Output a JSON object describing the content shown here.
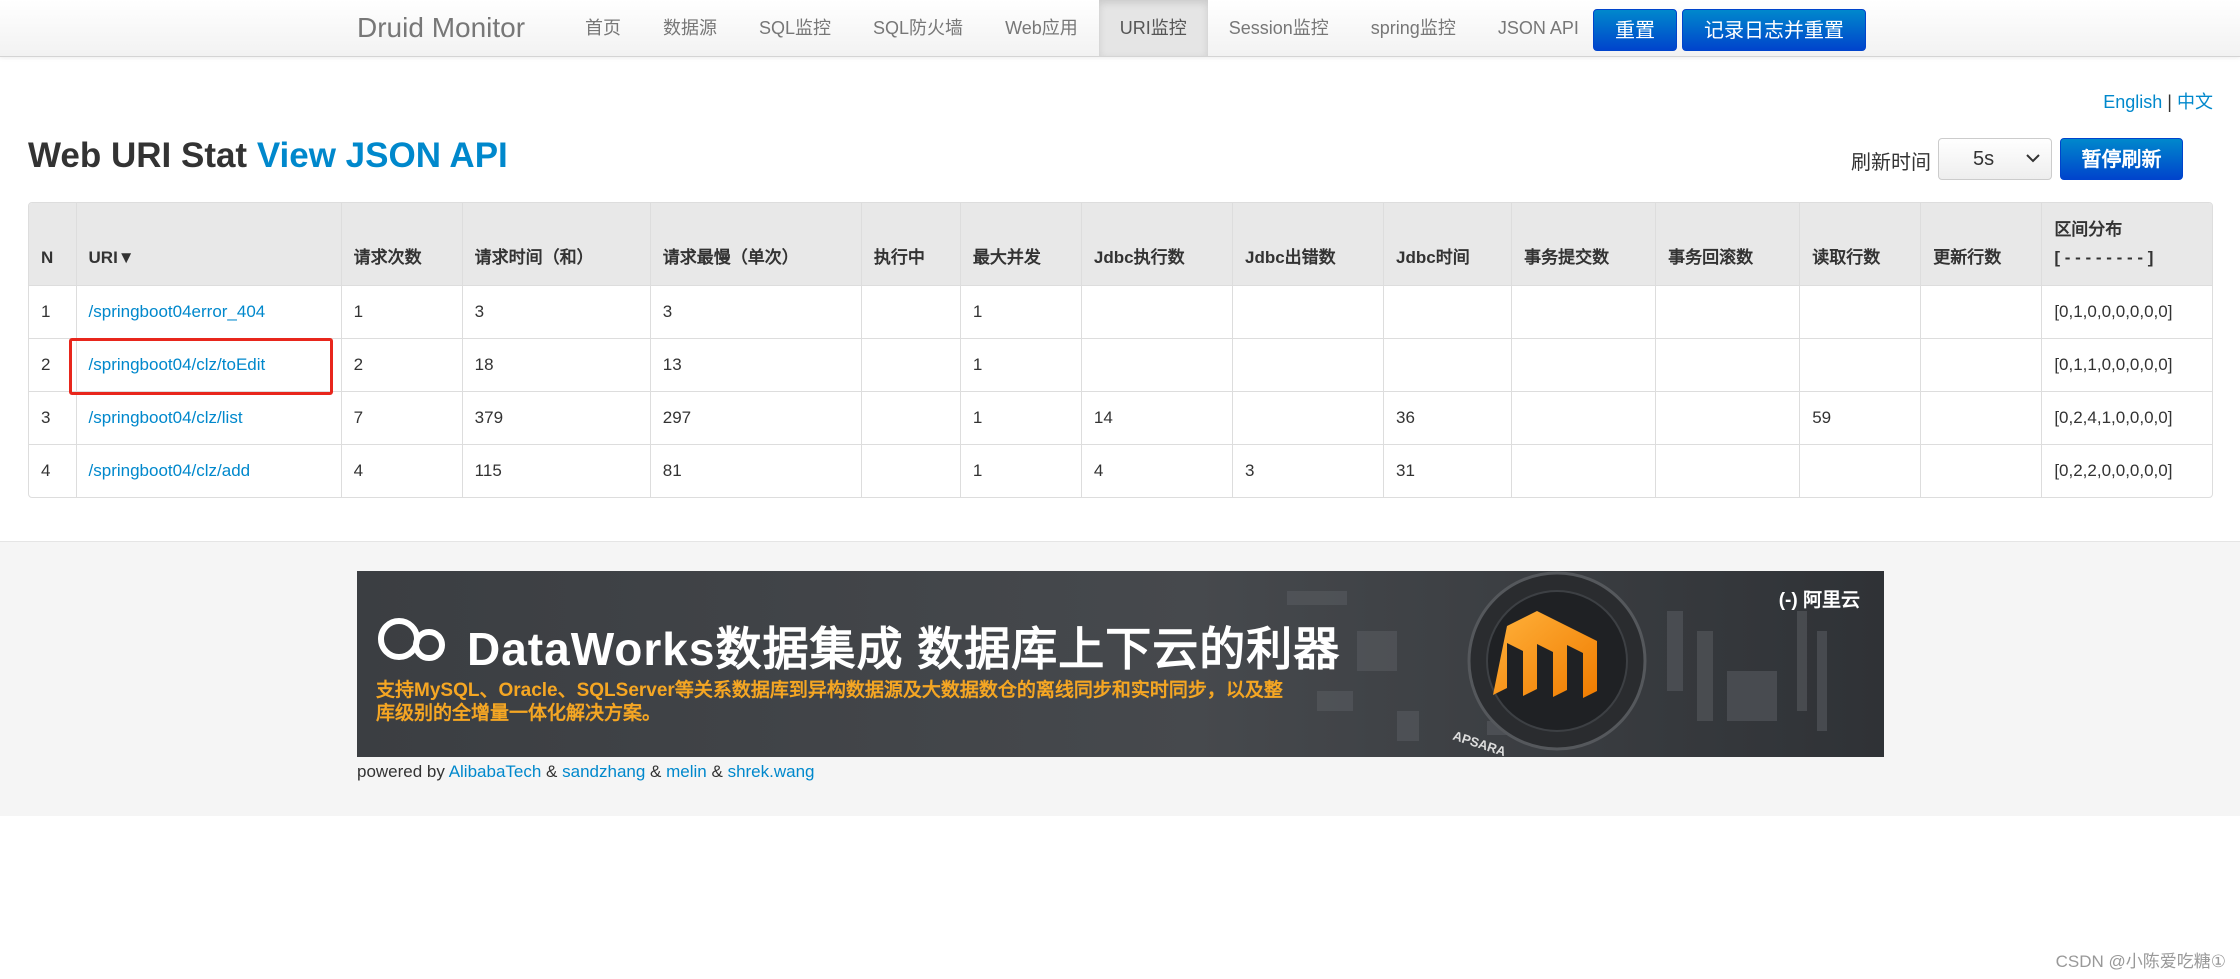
{
  "navbar": {
    "brand": "Druid Monitor",
    "items": [
      "首页",
      "数据源",
      "SQL监控",
      "SQL防火墙",
      "Web应用",
      "URI监控",
      "Session监控",
      "spring监控",
      "JSON API"
    ],
    "active_index": 5,
    "reset_label": "重置",
    "log_reset_label": "记录日志并重置"
  },
  "lang": {
    "english": "English",
    "separator": "|",
    "chinese": "中文"
  },
  "page": {
    "title": "Web URI Stat",
    "api_link": "View JSON API",
    "refresh_label": "刷新时间",
    "refresh_value": "5s",
    "pause_label": "暂停刷新"
  },
  "table": {
    "headers": [
      "N",
      "URI▼",
      "请求次数",
      "请求时间（和）",
      "请求最慢（单次）",
      "执行中",
      "最大并发",
      "Jdbc执行数",
      "Jdbc出错数",
      "Jdbc时间",
      "事务提交数",
      "事务回滚数",
      "读取行数",
      "更新行数",
      "区间分布"
    ],
    "dist_header_sub": "[ - - - - - - - - ]",
    "rows": [
      [
        "1",
        "/springboot04error_404",
        "1",
        "3",
        "3",
        "",
        "1",
        "",
        "",
        "",
        "",
        "",
        "",
        "",
        "[0,1,0,0,0,0,0,0]"
      ],
      [
        "2",
        "/springboot04/clz/toEdit",
        "2",
        "18",
        "13",
        "",
        "1",
        "",
        "",
        "",
        "",
        "",
        "",
        "",
        "[0,1,1,0,0,0,0,0]"
      ],
      [
        "3",
        "/springboot04/clz/list",
        "7",
        "379",
        "297",
        "",
        "1",
        "14",
        "",
        "36",
        "",
        "",
        "59",
        "",
        "[0,2,4,1,0,0,0,0]"
      ],
      [
        "4",
        "/springboot04/clz/add",
        "4",
        "115",
        "81",
        "",
        "1",
        "4",
        "3",
        "31",
        "",
        "",
        "",
        "",
        "[0,2,2,0,0,0,0,0]"
      ]
    ],
    "highlighted_row": 1
  },
  "banner": {
    "title": "DataWorks数据集成 数据库上下云的利器",
    "subtitle": "支持MySQL、Oracle、SQLServer等关系数据库到异构数据源及大数据数仓的离线同步和实时同步，以及整库级别的全增量一体化解决方案。",
    "brand": "阿里云",
    "brand_mark": "(-)",
    "logo_text": "APSARA"
  },
  "footer": {
    "powered_by": "powered by",
    "authors": [
      "AlibabaTech",
      "sandzhang",
      "melin",
      "shrek.wang"
    ],
    "amp": "&"
  },
  "watermark": "CSDN @小陈爱吃糖①",
  "colors": {
    "link": "#0088cc",
    "primary": "#0055cc",
    "highlight_box": "#e8261c",
    "banner_accent": "#f5a623"
  }
}
